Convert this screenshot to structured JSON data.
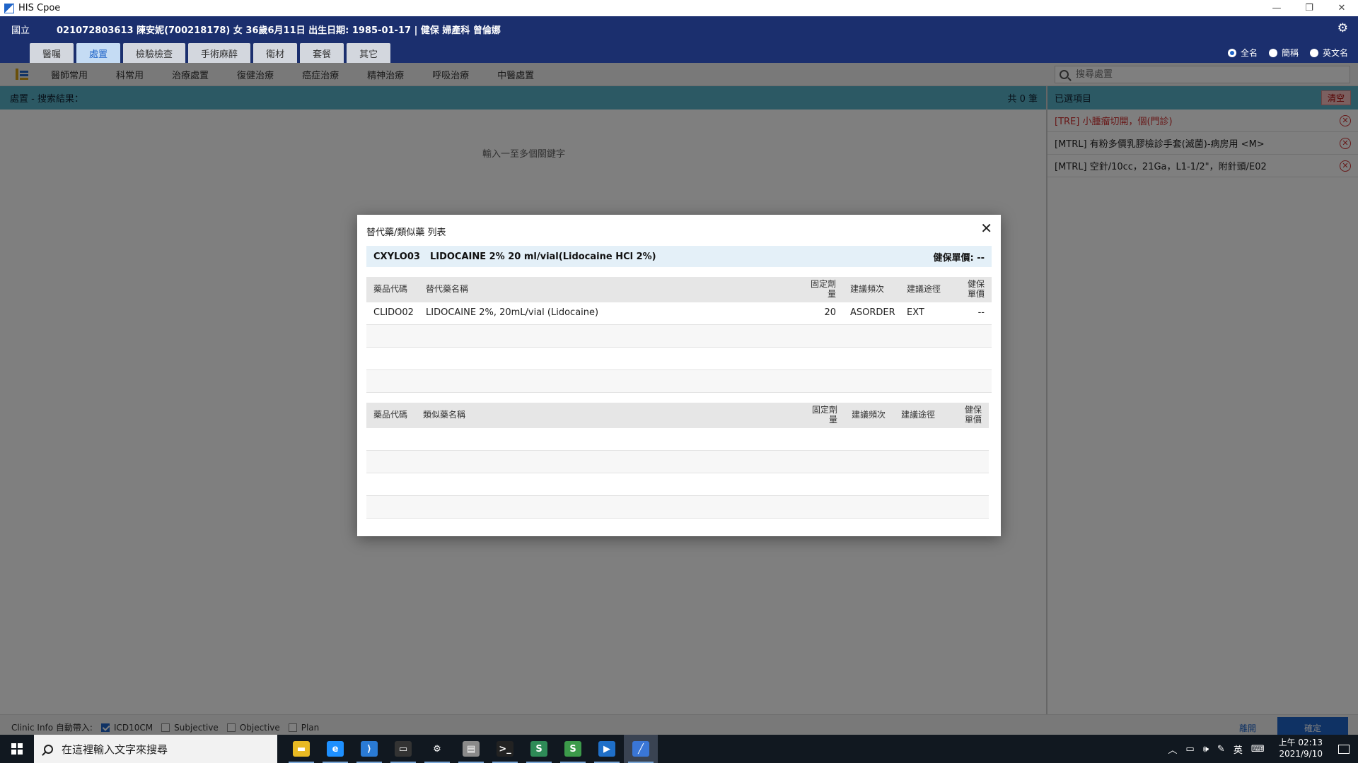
{
  "window": {
    "title": "HIS Cpoe",
    "controls": [
      "—",
      "❐",
      "✕"
    ]
  },
  "header": {
    "hospital": "國立",
    "patient_info": "021072803613 陳安妮(700218178) 女 36歲6月11日 出生日期: 1985-01-17 | 健保 婦產科 曾倫娜",
    "tabs": [
      "醫囑",
      "處置",
      "檢驗檢查",
      "手術麻醉",
      "衛材",
      "套餐",
      "其它"
    ],
    "active_tab": "處置",
    "name_options": [
      {
        "label": "全名",
        "selected": true
      },
      {
        "label": "簡稱",
        "selected": false
      },
      {
        "label": "英文名",
        "selected": false
      }
    ]
  },
  "subnav": {
    "items": [
      "醫師常用",
      "科常用",
      "治療處置",
      "復健治療",
      "癌症治療",
      "精神治療",
      "呼吸治療",
      "中醫處置"
    ]
  },
  "search": {
    "placeholder": "搜尋處置"
  },
  "results": {
    "title": "處置 - 搜索結果：",
    "count": "共 0 筆",
    "hint": "輸入一至多個關鍵字"
  },
  "selected": {
    "title": "已選項目",
    "clear_label": "清空",
    "items": [
      {
        "text": "[TRE] 小腫瘤切開，個(門診)",
        "highlight": true
      },
      {
        "text": "[MTRL] 有粉多價乳膠檢診手套(滅菌)-病房用 <M>",
        "highlight": false
      },
      {
        "text": "[MTRL] 空針/10cc，21Ga，L1-1/2\"，附針頭/E02",
        "highlight": false
      }
    ]
  },
  "bottom": {
    "clinic_label": "Clinic Info 自動帶入:",
    "checks": [
      {
        "label": "ICD10CM",
        "checked": true
      },
      {
        "label": "Subjective",
        "checked": false
      },
      {
        "label": "Objective",
        "checked": false
      },
      {
        "label": "Plan",
        "checked": false
      }
    ],
    "close_label": "離開",
    "ok_label": "確定"
  },
  "dialog": {
    "title": "替代藥/類似藥 列表",
    "close_icon": "✕",
    "drug_code": "CXYLO03",
    "drug_name": "LIDOCAINE 2% 20 ml/vial(Lidocaine HCl 2%)",
    "drug_price": "健保單價: --",
    "alt_table": {
      "headers": [
        "藥品代碼",
        "替代藥名稱",
        "固定劑量",
        "建議頻次",
        "建議途徑",
        "健保單價"
      ],
      "rows": [
        [
          "CLIDO02",
          "LIDOCAINE 2%, 20mL/vial (Lidocaine)",
          "20",
          "ASORDER",
          "EXT",
          "--"
        ]
      ]
    },
    "similar_table": {
      "headers": [
        "藥品代碼",
        "類似藥名稱",
        "固定劑量",
        "建議頻次",
        "建議途徑",
        "健保單價"
      ],
      "rows": []
    }
  },
  "taskbar": {
    "search_placeholder": "在這裡輸入文字來搜尋",
    "apps": [
      {
        "name": "file-explorer-icon",
        "color": "#e8b923",
        "glyph": "▬"
      },
      {
        "name": "edge-icon",
        "color": "#1e90ff",
        "glyph": "e"
      },
      {
        "name": "vscode-icon",
        "color": "#2a7ad4",
        "glyph": "⟩"
      },
      {
        "name": "terminal-icon",
        "color": "#333",
        "glyph": "▭"
      },
      {
        "name": "settings-icon",
        "color": "#111820",
        "glyph": "⚙"
      },
      {
        "name": "printer-icon",
        "color": "#8a8a8a",
        "glyph": "▤"
      },
      {
        "name": "cmd-icon",
        "color": "#222",
        "glyph": ">_"
      },
      {
        "name": "edge-dev-icon",
        "color": "#2e8b57",
        "glyph": "S"
      },
      {
        "name": "edge-beta-icon",
        "color": "#3c9a4a",
        "glyph": "S"
      },
      {
        "name": "media-icon",
        "color": "#1f6fc8",
        "glyph": "▶"
      },
      {
        "name": "his-cpoe-icon",
        "color": "#3a76d6",
        "glyph": "╱"
      }
    ],
    "tray": {
      "ime": "英",
      "time": "上午 02:13",
      "date": "2021/9/10"
    }
  }
}
